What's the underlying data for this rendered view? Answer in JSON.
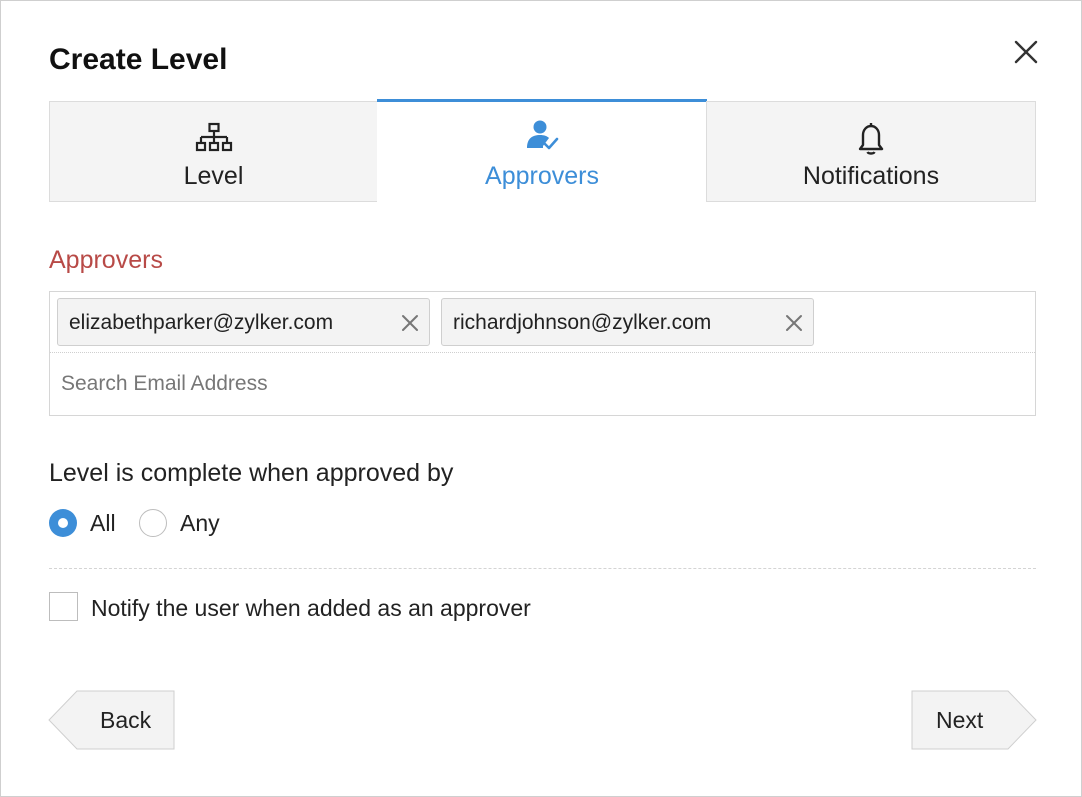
{
  "dialog": {
    "title": "Create Level",
    "close_icon": "close-icon"
  },
  "tabs": [
    {
      "label": "Level",
      "icon": "hierarchy-icon",
      "active": false
    },
    {
      "label": "Approvers",
      "icon": "user-check-icon",
      "active": true
    },
    {
      "label": "Notifications",
      "icon": "bell-icon",
      "active": false
    }
  ],
  "approvers": {
    "heading": "Approvers",
    "chips": [
      {
        "email": "elizabethparker@zylker.com"
      },
      {
        "email": "richardjohnson@zylker.com"
      }
    ],
    "search_placeholder": "Search Email Address",
    "search_value": ""
  },
  "completion": {
    "question": "Level is complete when approved by",
    "options": [
      {
        "label": "All",
        "selected": true
      },
      {
        "label": "Any",
        "selected": false
      }
    ]
  },
  "notify": {
    "label": "Notify the user when added as an approver",
    "checked": false
  },
  "buttons": {
    "back": "Back",
    "next": "Next"
  },
  "colors": {
    "accent": "#3d8ed8",
    "heading_red": "#b84a47",
    "tab_inactive_bg": "#f4f4f4"
  }
}
